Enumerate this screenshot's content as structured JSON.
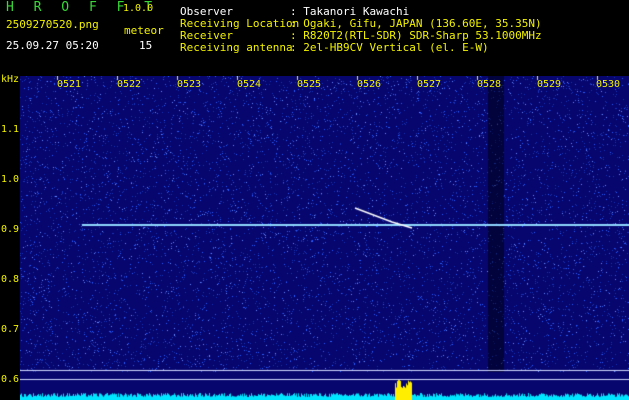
{
  "header": {
    "brand": "H R O F F T",
    "version": "1.0.0",
    "filename": "2509270520.png",
    "datetime": "25.09.27 05:20",
    "meteor_label": "meteor",
    "meteor_count": "15",
    "fields": [
      {
        "label": "Observer",
        "value": ": Takanori Kawachi"
      },
      {
        "label": "Receiving Location",
        "value": ": Ogaki, Gifu, JAPAN (136.60E, 35.35N)"
      },
      {
        "label": "Receiver",
        "value": ": R820T2(RTL-SDR) SDR-Sharp 53.1000MHz"
      },
      {
        "label": "Receiving antenna",
        "value": ": 2el-HB9CV Vertical (el. E-W)"
      }
    ]
  },
  "spectrogram": {
    "y_unit": "kHz",
    "y_ticks": [
      "1.1",
      "1.0",
      "0.9",
      "0.8",
      "0.7",
      "0.6"
    ],
    "time_ticks": [
      "0521",
      "0522",
      "0523",
      "0524",
      "0525",
      "0526",
      "0527",
      "0528",
      "0529",
      "0530"
    ],
    "colors": {
      "background": "#06066e",
      "noise": "#2a5cff",
      "carrier": "#8fd8ff",
      "meteor": "#ffffff",
      "level": "#00e5ff",
      "level_peak": "#ffee00"
    }
  }
}
